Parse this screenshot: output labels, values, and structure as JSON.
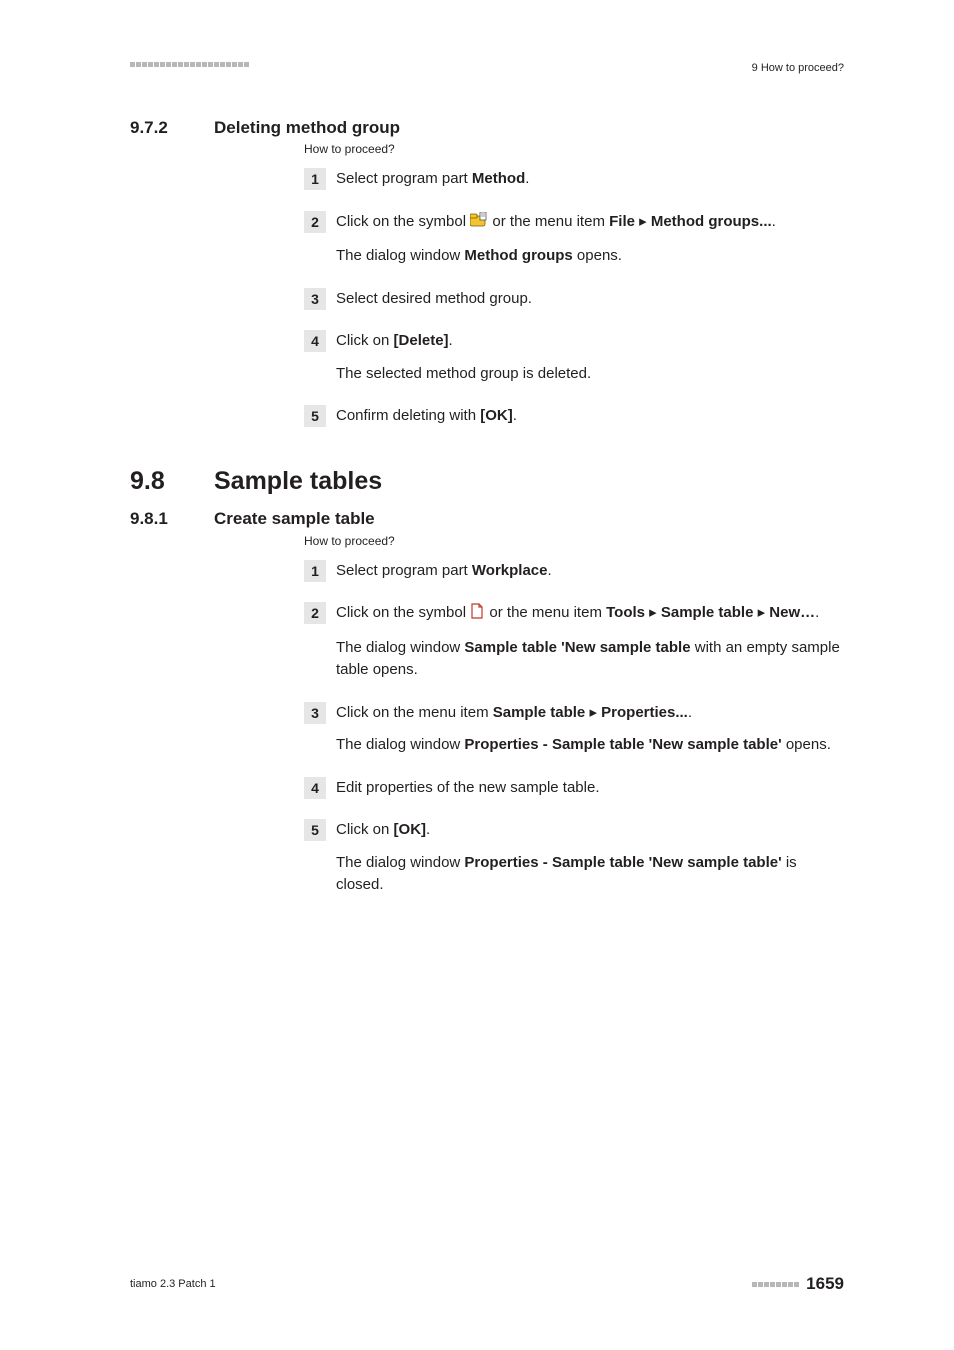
{
  "header": {
    "breadcrumb": "9 How to proceed?"
  },
  "section972": {
    "num": "9.7.2",
    "title": "Deleting method group",
    "howto": "How to proceed?",
    "s1_a": "Select program part ",
    "s1_b": "Method",
    "s1_c": ".",
    "s2_a": "Click on the symbol ",
    "s2_b": " or the menu item ",
    "s2_c": "File",
    "s2_d": "Method groups...",
    "s2_e": ".",
    "s2_f": "The dialog window ",
    "s2_g": "Method groups",
    "s2_h": " opens.",
    "s3": "Select desired method group.",
    "s4_a": "Click on ",
    "s4_b": "[Delete]",
    "s4_c": ".",
    "s4_d": "The selected method group is deleted.",
    "s5_a": "Confirm deleting with ",
    "s5_b": "[OK]",
    "s5_c": "."
  },
  "chapter98": {
    "num": "9.8",
    "title": "Sample tables"
  },
  "section981": {
    "num": "9.8.1",
    "title": "Create sample table",
    "howto": "How to proceed?",
    "s1_a": "Select program part ",
    "s1_b": "Workplace",
    "s1_c": ".",
    "s2_a": "Click on the symbol ",
    "s2_b": " or the menu item ",
    "s2_c": "Tools",
    "s2_d": "Sample table",
    "s2_e": "New…",
    "s2_f": ".",
    "s2_g": "The dialog window ",
    "s2_h": "Sample table 'New sample table",
    "s2_i": " with an empty sample table opens.",
    "s3_a": "Click on the menu item ",
    "s3_b": "Sample table",
    "s3_c": "Properties...",
    "s3_d": ".",
    "s3_e": "The dialog window ",
    "s3_f": "Properties - Sample table 'New sample table'",
    "s3_g": " opens.",
    "s4": "Edit properties of the new sample table.",
    "s5_a": "Click on ",
    "s5_b": "[OK]",
    "s5_c": ".",
    "s5_d": "The dialog window ",
    "s5_e": "Properties - Sample table 'New sample table'",
    "s5_f": " is closed."
  },
  "footer": {
    "left": "tiamo 2.3 Patch 1",
    "page": "1659"
  },
  "stepnums": {
    "n1": "1",
    "n2": "2",
    "n3": "3",
    "n4": "4",
    "n5": "5"
  }
}
